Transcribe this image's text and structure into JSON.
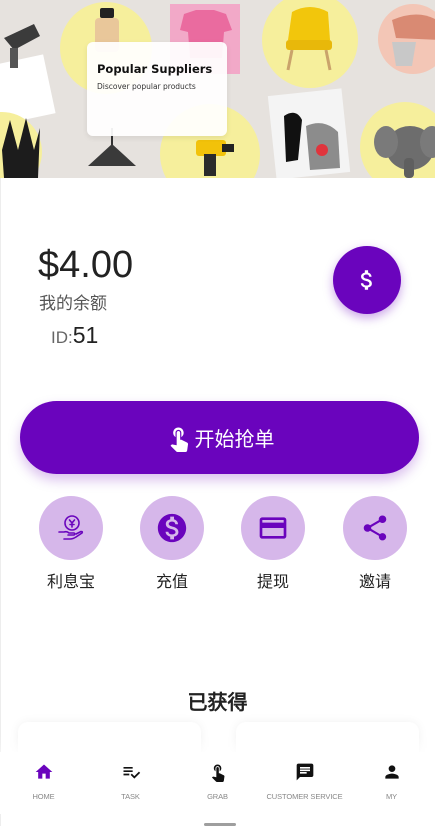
{
  "banner": {
    "title": "Popular Suppliers",
    "subtitle": "Discover popular products"
  },
  "account": {
    "balance": "$4.00",
    "balance_label": "我的余额",
    "id_label": "ID:",
    "id_value": "51",
    "currency_icon": "dollar-icon"
  },
  "start_button": {
    "label": "开始抢单",
    "icon": "touch-icon"
  },
  "actions": [
    {
      "label": "利息宝",
      "icon": "yuan-hand-icon"
    },
    {
      "label": "充值",
      "icon": "dollar-circle-icon"
    },
    {
      "label": "提现",
      "icon": "credit-card-icon"
    },
    {
      "label": "邀请",
      "icon": "share-icon"
    }
  ],
  "section_title": "已获得",
  "nav": [
    {
      "label": "HOME",
      "icon": "home-icon",
      "active": true
    },
    {
      "label": "TASK",
      "icon": "playlist-check-icon",
      "active": false
    },
    {
      "label": "GRAB",
      "icon": "touch-icon",
      "active": false
    },
    {
      "label": "CUSTOMER SERVICE",
      "icon": "chat-icon",
      "active": false
    },
    {
      "label": "MY",
      "icon": "person-icon",
      "active": false
    }
  ],
  "colors": {
    "accent": "#6a04bd",
    "action_circle": "#d6b7ea"
  }
}
